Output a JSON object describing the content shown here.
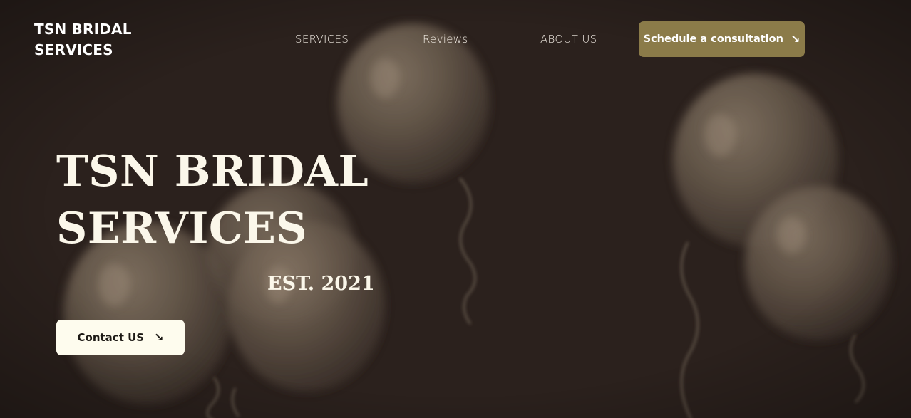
{
  "brand": {
    "line1": "TSN BRIDAL",
    "line2": "SERVICES"
  },
  "nav": {
    "services": "SERVICES",
    "reviews": "Reviews",
    "about": "ABOUT US",
    "consult_label": "Schedule a consultation",
    "consult_icon": "arrow-down-right-icon"
  },
  "hero": {
    "title_line1": "TSN BRIDAL",
    "title_line2": "SERVICES",
    "established": "EST. 2021",
    "contact_label": "Contact US",
    "contact_icon": "arrow-down-right-icon",
    "background": "balloons-photo"
  },
  "colors": {
    "background": "#2b211d",
    "accent": "#8b7b49",
    "button_light": "#fefcee",
    "text_light": "#fbf7ea"
  }
}
